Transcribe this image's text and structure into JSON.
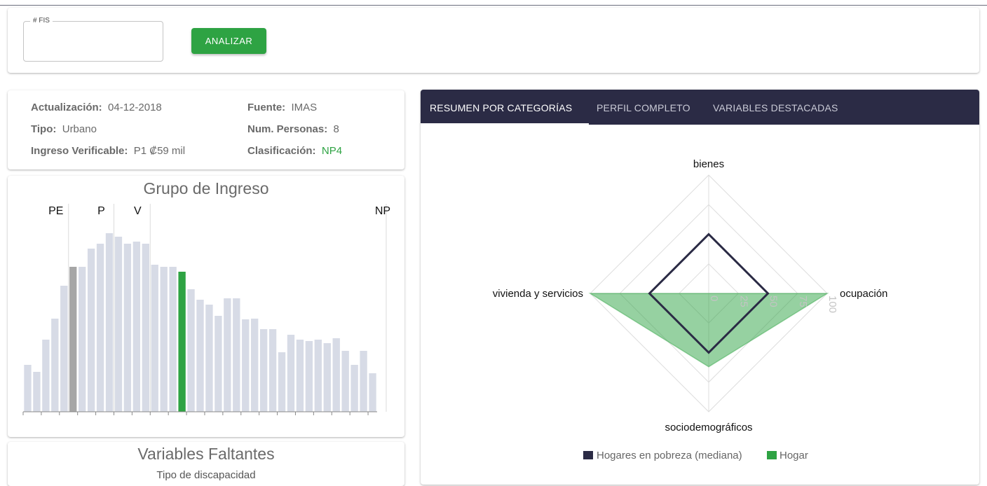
{
  "search": {
    "label": "# FIS",
    "value": "",
    "button_label": "ANALIZAR"
  },
  "info": {
    "actualizacion": {
      "label": "Actualización:",
      "value": "04-12-2018"
    },
    "fuente": {
      "label": "Fuente:",
      "value": "IMAS"
    },
    "tipo": {
      "label": "Tipo:",
      "value": "Urbano"
    },
    "num_personas": {
      "label": "Num. Personas:",
      "value": "8"
    },
    "ingreso": {
      "label": "Ingreso Verificable:",
      "value": "P1 ₡59 mil"
    },
    "clasificacion": {
      "label": "Clasificación:",
      "value": "NP4",
      "color": "#2ea343"
    }
  },
  "income_chart": {
    "title": "Grupo de Ingreso",
    "markers": [
      {
        "label": "PE",
        "bin": 4
      },
      {
        "label": "P",
        "bin": 9
      },
      {
        "label": "V",
        "bin": 13
      },
      {
        "label": "NP",
        "bin": 39
      }
    ],
    "bar_color": "#d7dbe6",
    "highlight_gray_color": "#a6a6a6",
    "highlight_green_color": "#2ea343"
  },
  "chart_data": [
    {
      "type": "bar",
      "title": "Grupo de Ingreso",
      "values": [
        67,
        57,
        103,
        133,
        180,
        207,
        207,
        233,
        240,
        255,
        250,
        240,
        243,
        240,
        210,
        207,
        207,
        200,
        175,
        160,
        153,
        137,
        162,
        162,
        132,
        133,
        118,
        118,
        85,
        110,
        103,
        101,
        103,
        98,
        105,
        87,
        67,
        87,
        55
      ],
      "highlight_gray_index": 5,
      "highlight_green_index": 17,
      "ylim": [
        0,
        260
      ]
    },
    {
      "type": "radar",
      "axes": [
        "bienes",
        "ocupación",
        "sociodemográficos",
        "vivienda y servicios"
      ],
      "rlim": [
        0,
        100
      ],
      "ticks": [
        "0",
        "25",
        "50",
        "75",
        "100"
      ],
      "series": [
        {
          "name": "Hogares en pobreza (mediana)",
          "values": [
            50,
            50,
            50,
            50
          ],
          "color": "#2b2b45"
        },
        {
          "name": "Hogar",
          "values": [
            0,
            100,
            62,
            100
          ],
          "color": "#2ea343"
        }
      ]
    }
  ],
  "missing": {
    "title": "Variables Faltantes",
    "items": [
      "Tipo de discapacidad"
    ]
  },
  "tabs": [
    {
      "label": "RESUMEN POR CATEGORÍAS",
      "active": true
    },
    {
      "label": "PERFIL COMPLETO",
      "active": false
    },
    {
      "label": "VARIABLES DESTACADAS",
      "active": false
    }
  ]
}
